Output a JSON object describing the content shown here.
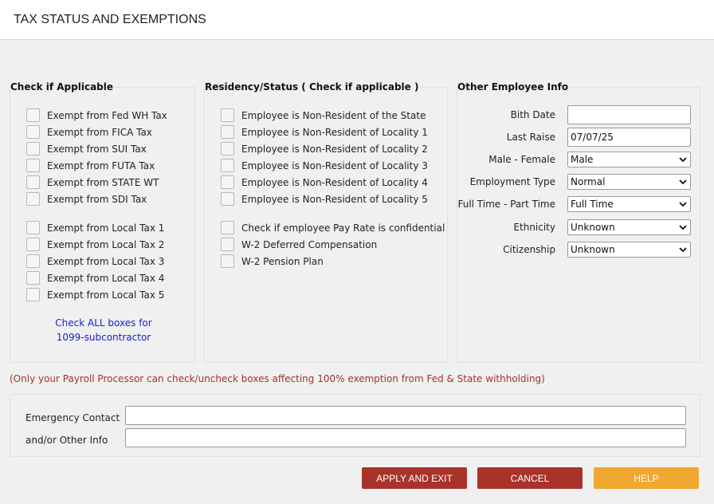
{
  "header": {
    "title": "TAX STATUS AND EXEMPTIONS"
  },
  "applicable": {
    "legend": "Check if Applicable",
    "group1": [
      "Exempt from Fed WH Tax",
      "Exempt from FICA Tax",
      "Exempt from SUI Tax",
      "Exempt from FUTA Tax",
      "Exempt from STATE WT",
      "Exempt from SDI Tax"
    ],
    "group2": [
      "Exempt from Local Tax 1",
      "Exempt from Local Tax 2",
      "Exempt from Local Tax 3",
      "Exempt from Local Tax 4",
      "Exempt from Local Tax 5"
    ],
    "note_line1": "Check ALL boxes for",
    "note_line2": "1099-subcontractor"
  },
  "residency": {
    "legend": "Residency/Status ( Check if applicable )",
    "group1": [
      "Employee is Non-Resident of the State",
      "Employee is Non-Resident of Locality 1",
      "Employee is Non-Resident of Locality 2",
      "Employee is Non-Resident of Locality 3",
      "Employee is Non-Resident of Locality 4",
      "Employee is Non-Resident of Locality 5"
    ],
    "group2": [
      "Check if employee Pay Rate is confidential",
      "W-2 Deferred Compensation",
      "W-2 Pension Plan"
    ]
  },
  "other": {
    "legend": "Other Employee Info",
    "birth_date_label": "Bith Date",
    "birth_date_value": "",
    "last_raise_label": "Last Raise",
    "last_raise_value": "07/07/25",
    "gender_label": "Male - Female",
    "gender_value": "Male",
    "employment_type_label": "Employment Type",
    "employment_type_value": "Normal",
    "fulltime_label": "Full Time - Part Time",
    "fulltime_value": "Full Time",
    "ethnicity_label": "Ethnicity",
    "ethnicity_value": "Unknown",
    "citizenship_label": "Citizenship",
    "citizenship_value": "Unknown"
  },
  "warning": "(Only your Payroll Processor can check/uncheck boxes affecting 100% exemption from Fed & State withholding)",
  "emergency": {
    "label1": "Emergency Contact",
    "label2": "and/or Other Info",
    "value1": "",
    "value2": ""
  },
  "buttons": {
    "apply": "APPLY AND EXIT",
    "cancel": "CANCEL",
    "help": "HELP"
  },
  "colors": {
    "button_red": "#a8332b",
    "button_orange": "#f0a830",
    "warning_text": "#a0332a",
    "link_text": "#1a1acd"
  }
}
